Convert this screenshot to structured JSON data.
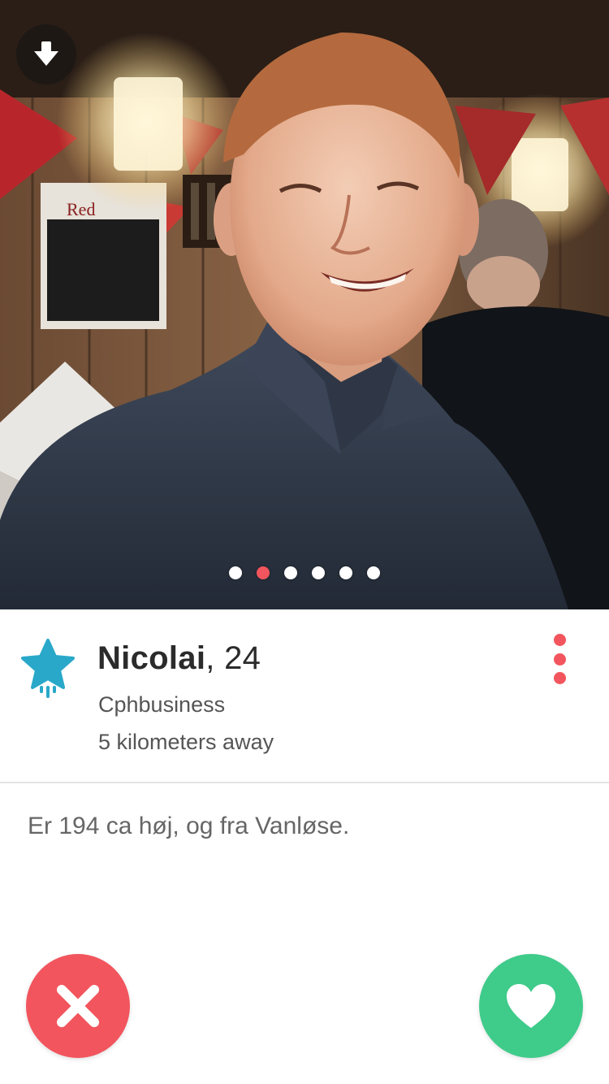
{
  "profile": {
    "name": "Nicolai",
    "age_text": ", 24",
    "school": "Cphbusiness",
    "distance": "5 kilometers away",
    "bio": "Er 194 ca høj, og fra Vanløse."
  },
  "photo": {
    "photo_count": 6,
    "active_photo_index": 1,
    "background_sign_text": "Red"
  },
  "icons": {
    "collapse": "arrow-down-icon",
    "badge": "star-badge-icon",
    "more": "vertical-dots-icon",
    "nope": "close-x-icon",
    "like": "heart-icon"
  },
  "colors": {
    "accent_red": "#f2555d",
    "like_green": "#3fcb8a",
    "badge_blue": "#29a8c9",
    "text_dark": "#2b2b2b",
    "text_gray": "#555555"
  }
}
